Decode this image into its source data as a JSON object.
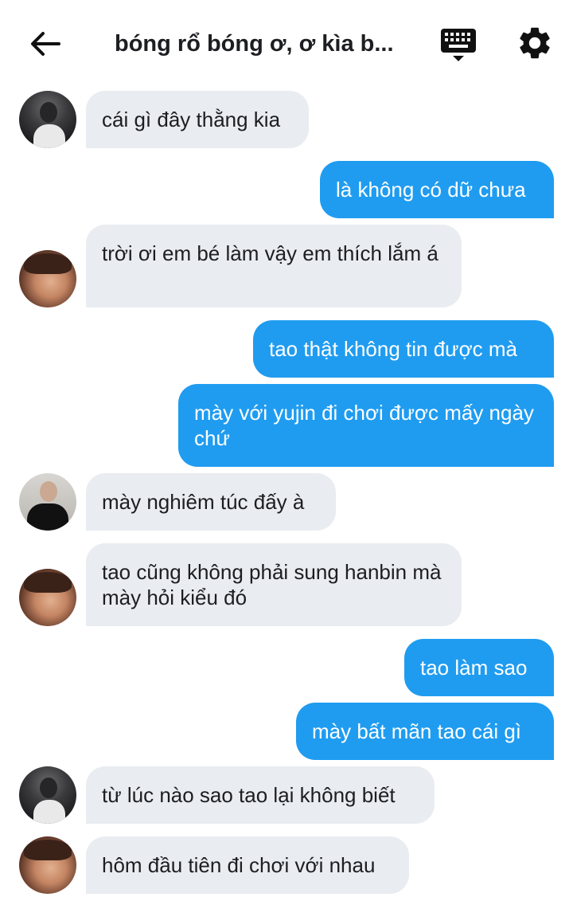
{
  "header": {
    "title": "bóng rổ bóng ơ, ơ kìa b...",
    "back_icon": "arrow-left-icon",
    "keyboard_icon": "keyboard-icon",
    "settings_icon": "gear-icon"
  },
  "colors": {
    "outgoing_bubble": "#1f9cf0",
    "incoming_bubble": "#e9ecf0"
  },
  "messages": [
    {
      "from": "incoming",
      "text": "cái gì đây thằng kia"
    },
    {
      "from": "outgoing",
      "text": "là không có dữ chưa"
    },
    {
      "from": "incoming",
      "text": "trời ơi em bé làm vậy em thích lắm á"
    },
    {
      "from": "outgoing",
      "text": "tao thật không tin được mà"
    },
    {
      "from": "outgoing",
      "text": "mày với yujin đi chơi được mấy ngày chứ"
    },
    {
      "from": "incoming",
      "text": "mày nghiêm túc đấy à"
    },
    {
      "from": "incoming",
      "text": "tao cũng không phải sung hanbin mà mày hỏi kiểu đó"
    },
    {
      "from": "outgoing",
      "text": "tao làm sao"
    },
    {
      "from": "outgoing",
      "text": "mày bất mãn tao cái gì"
    },
    {
      "from": "incoming",
      "text": "từ lúc nào sao tao lại không biết"
    },
    {
      "from": "incoming",
      "text": "hôm đầu tiên đi chơi với nhau"
    }
  ]
}
